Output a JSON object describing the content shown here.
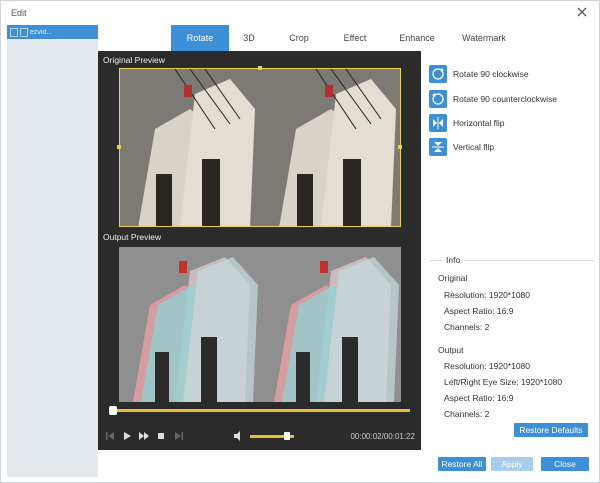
{
  "window": {
    "title": "Edit"
  },
  "sidebar": {
    "item_label": "ezvid..."
  },
  "tabs": [
    "Rotate",
    "3D",
    "Crop",
    "Effect",
    "Enhance",
    "Watermark"
  ],
  "preview": {
    "original_label": "Original Preview",
    "output_label": "Output Preview",
    "time": "00:00:02/00:01:22",
    "playback_progress": 0.0,
    "volume_level": 0.85
  },
  "rotate": {
    "items": [
      {
        "label": "Rotate 90 clockwise",
        "icon": "rotate-clockwise-icon"
      },
      {
        "label": "Rotate 90 counterclockwise",
        "icon": "rotate-counterclockwise-icon"
      },
      {
        "label": "Horizontal flip",
        "icon": "horizontal-flip-icon"
      },
      {
        "label": "Vertical flip",
        "icon": "vertical-flip-icon"
      }
    ]
  },
  "info": {
    "title": "Info",
    "original_heading": "Original",
    "original": [
      "Resolution: 1920*1080",
      "Aspect Ratio: 16:9",
      "Channels: 2"
    ],
    "output_heading": "Output",
    "output": [
      "Resolution: 1920*1080",
      "Left/Right Eye Size: 1920*1080",
      "Aspect Ratio: 16:9",
      "Channels: 2"
    ]
  },
  "buttons": {
    "restore_defaults": "Restore Defaults",
    "restore_all": "Restore All",
    "apply": "Apply",
    "close": "Close"
  },
  "colors": {
    "accent": "#3d8fd8",
    "timeline": "#e7be2d",
    "crop_border": "#e6d34a"
  }
}
